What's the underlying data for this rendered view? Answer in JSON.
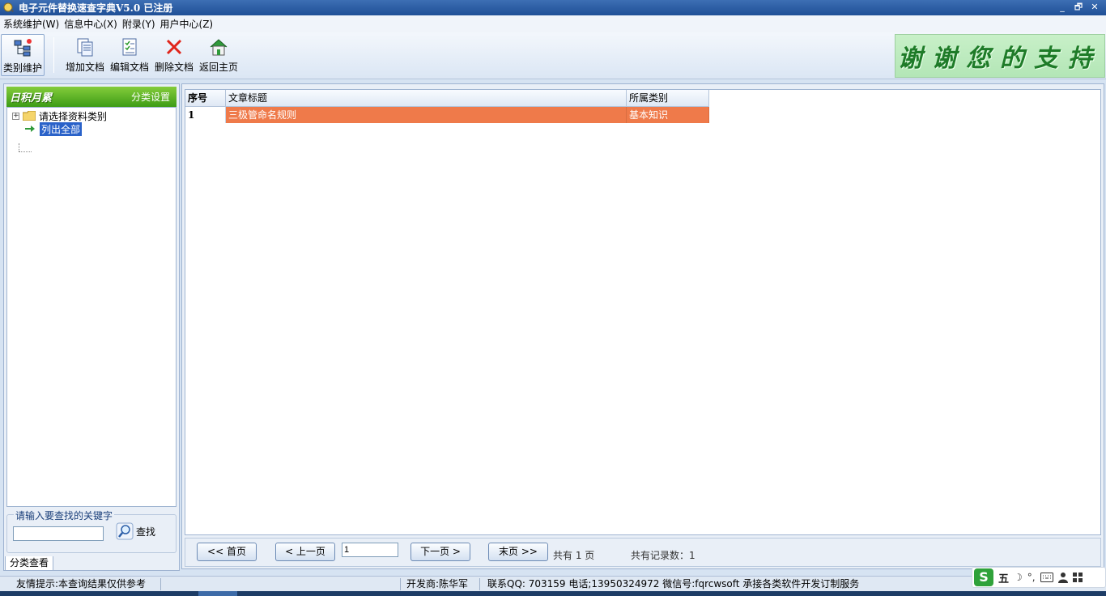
{
  "window": {
    "title": "电子元件替换速查字典V5.0  已注册",
    "controls": {
      "minimize": "_",
      "restore": "🗗",
      "close": "✕"
    }
  },
  "menu": [
    {
      "label": "系统维护(W)"
    },
    {
      "label": "信息中心(X)"
    },
    {
      "label": "附录(Y)"
    },
    {
      "label": "用户中心(Z)"
    }
  ],
  "toolbar": {
    "category_maintain": "类别维护",
    "add_doc": "增加文档",
    "edit_doc": "编辑文档",
    "delete_doc": "删除文档",
    "return_home": "返回主页"
  },
  "banner": {
    "text": "谢谢您的支持"
  },
  "left_panel": {
    "header_logo": "日积月累",
    "header_action": "分类设置",
    "tree": {
      "root_label": "请选择资料类别",
      "list_all_label": "列出全部"
    },
    "search": {
      "legend": "请输入要查找的关键字",
      "value": "",
      "button_label": "查找"
    },
    "tab_label": "分类查看"
  },
  "grid": {
    "columns": [
      "序号",
      "文章标题",
      "所属类别"
    ],
    "rows": [
      {
        "index": "1",
        "title": "三极管命名规则",
        "category": "基本知识"
      }
    ]
  },
  "pager": {
    "first": "<< 首页",
    "prev": "< 上一页",
    "page_value": "1",
    "next": "下一页 >",
    "last": "末页 >>",
    "total_pages": "共有  1  页",
    "total_records": "共有记录数：1"
  },
  "statusbar": {
    "tip": "友情提示:本查询结果仅供参考",
    "developer": "开发商:陈华军",
    "contact": "联系QQ: 703159 电话;13950324972 微信号:fqrcwsoft  承接各类软件开发订制服务"
  },
  "ime": {
    "logo": "S",
    "mode": "五",
    "punct": "°,",
    "moon": "☽"
  },
  "colors": {
    "selection": "#ef7a4a",
    "tree_header": "#3d9c16",
    "title_bar": "#1f4f96"
  }
}
